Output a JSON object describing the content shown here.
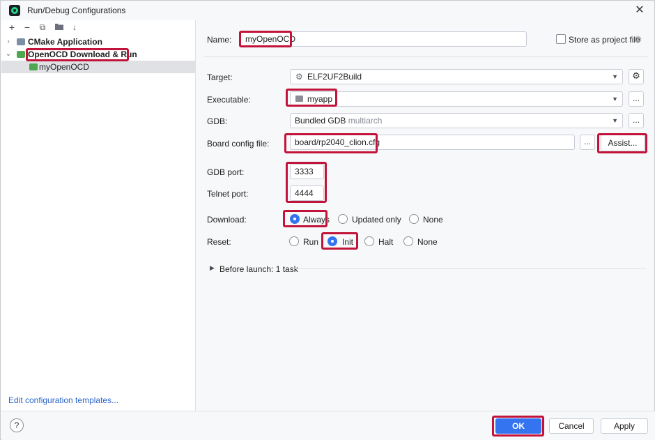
{
  "window": {
    "title": "Run/Debug Configurations",
    "close": "✕"
  },
  "toolbar": {
    "add": "+",
    "remove": "−",
    "copy": "⧉",
    "folder": "▸",
    "sort": "↓"
  },
  "tree": {
    "cmake": "CMake Application",
    "openocd": "OpenOCD Download & Run",
    "child": "myOpenOCD"
  },
  "edit_templates": "Edit configuration templates...",
  "form": {
    "name_label": "Name:",
    "name_value": "myOpenOCD",
    "store_label": "Store as project file",
    "target_label": "Target:",
    "target_value": "ELF2UF2Build",
    "executable_label": "Executable:",
    "executable_value": "myapp",
    "gdb_label": "GDB:",
    "gdb_value": "Bundled GDB",
    "gdb_hint": "multiarch",
    "board_label": "Board config file:",
    "board_value": "board/rp2040_clion.cfg",
    "browse": "...",
    "assist": "Assist...",
    "gdb_port_label": "GDB port:",
    "gdb_port_value": "3333",
    "telnet_port_label": "Telnet port:",
    "telnet_port_value": "4444",
    "download_label": "Download:",
    "download_options": [
      "Always",
      "Updated only",
      "None"
    ],
    "reset_label": "Reset:",
    "reset_options": [
      "Run",
      "Init",
      "Halt",
      "None"
    ],
    "before_launch": "Before launch: 1 task"
  },
  "buttons": {
    "help": "?",
    "ok": "OK",
    "cancel": "Cancel",
    "apply": "Apply"
  },
  "colors": {
    "highlight": "#c2143a",
    "accent": "#3574f0",
    "link": "#2a65c8"
  }
}
